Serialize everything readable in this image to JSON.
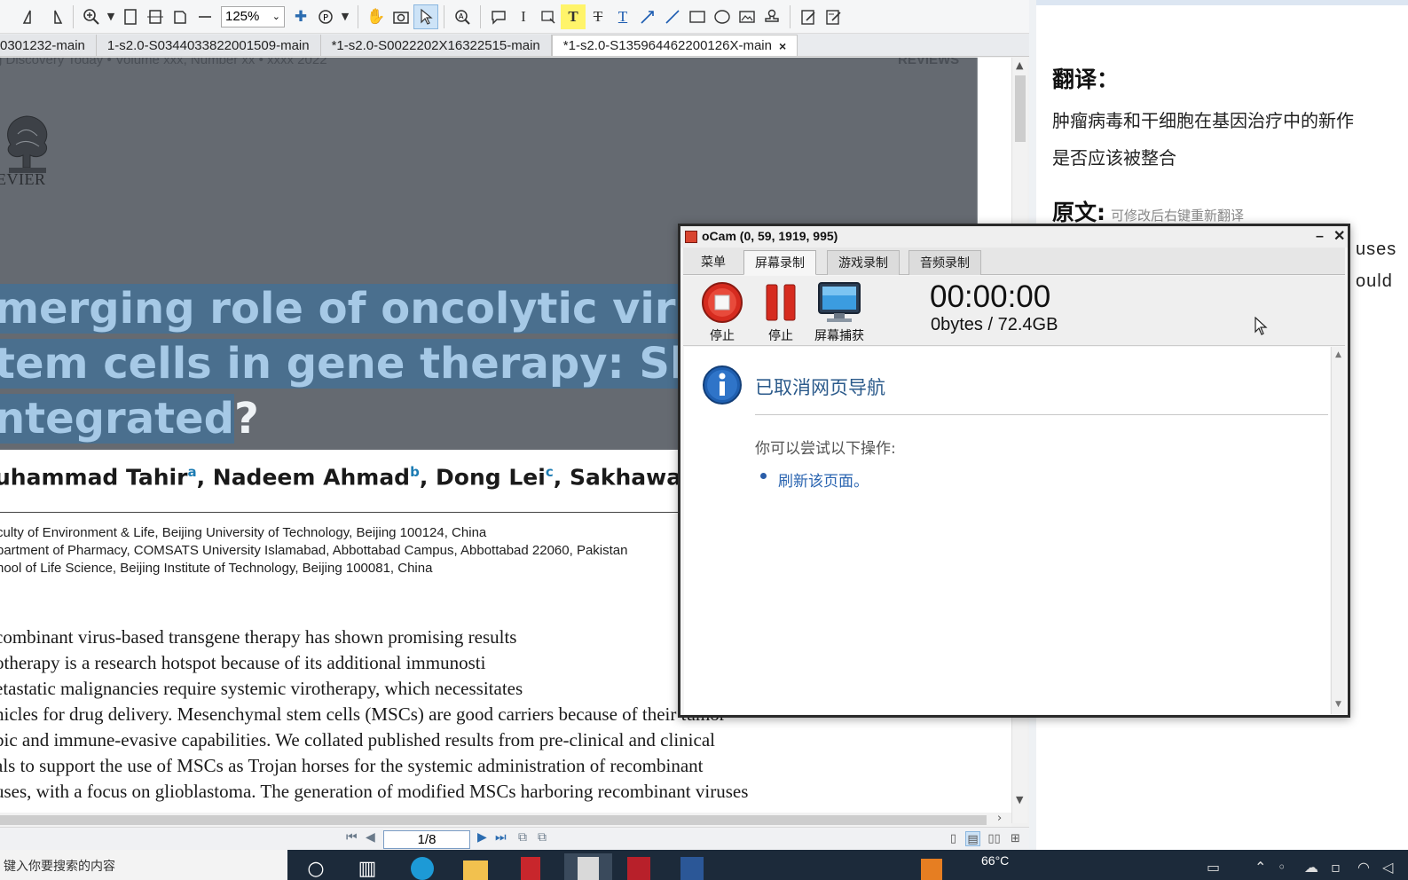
{
  "toolbar": {
    "zoom_value": "125%",
    "icons": [
      "rotate-left-icon",
      "rotate-right-icon",
      "zoom-in-icon",
      "fit-page-icon",
      "fit-width-icon",
      "actual-size-icon",
      "zoom-out-icon",
      "add-icon",
      "pan-icon",
      "snapshot-icon",
      "select-icon",
      "find-icon",
      "comment-icon",
      "text-select-icon",
      "textbox-icon",
      "highlight-icon",
      "strikethrough-icon",
      "underline-icon",
      "arrow-icon",
      "line-icon",
      "rectangle-icon",
      "ellipse-icon",
      "image-icon",
      "stamp-icon",
      "sign-icon",
      "edit-icon"
    ],
    "highlight_label": "T",
    "strike_label": "T",
    "underline_label": "T"
  },
  "tabs": [
    {
      "label": "0301232-main",
      "active": false
    },
    {
      "label": "1-s2.0-S0344033822001509-main",
      "active": false
    },
    {
      "label": "*1-s2.0-S0022202X16322515-main",
      "active": false
    },
    {
      "label": "*1-s2.0-S135964462200126X-main",
      "active": true,
      "close": "×"
    }
  ],
  "document": {
    "journal_line": "g Discovery Today • Volume xxx, Number xx • xxxx 2022",
    "section_label": "REVIEWS",
    "publisher": "EVIER",
    "title_lines": [
      {
        "hl": "merging role of oncolytic viru",
        "rest": ""
      },
      {
        "hl": "tem cells in gene therapy: Sho",
        "rest": ""
      },
      {
        "hl": "ntegrated",
        "rest": "?"
      }
    ],
    "authors": [
      {
        "name": "uhammad Tahir",
        "sup": "a"
      },
      {
        "name": "Nadeem Ahmad",
        "sup": "b"
      },
      {
        "name": "Dong Lei",
        "sup": "c"
      },
      {
        "name": "Sakhawat A",
        "sup": ""
      }
    ],
    "affiliations": [
      "culty of Environment & Life, Beijing University of Technology, Beijing 100124, China",
      "partment of Pharmacy, COMSATS University Islamabad, Abbottabad Campus, Abbottabad 22060, Pakistan",
      "nool of Life Science, Beijing Institute of Technology, Beijing 100081, China"
    ],
    "abstract_lines": [
      "combinant virus-based transgene therapy has shown promising results",
      "otherapy is a research hotspot because of its additional immunosti",
      "etastatic malignancies require systemic virotherapy, which necessitates",
      "hicles for drug delivery. Mesenchymal stem cells (MSCs) are good carriers because of their tumor",
      "pic and immune-evasive capabilities. We collated published results from pre-clinical and clinical",
      "als to support the use of MSCs as Trojan horses for the systemic administration of recombinant",
      "uses, with a focus on glioblastoma. The generation of modified MSCs harboring recombinant viruses"
    ]
  },
  "pagebar": {
    "page": "1/8"
  },
  "translation": {
    "heading": "翻译：",
    "text_line1": "肿瘤病毒和干细胞在基因治疗中的新作",
    "text_line2": "是否应该被整合",
    "orig_heading": "原文:",
    "orig_hint": "可修改后右键重新翻译",
    "orig_frag1": "uses",
    "orig_frag2": "ould"
  },
  "ocam": {
    "title": "oCam (0, 59, 1919, 995)",
    "tabs": [
      "菜单",
      "屏幕录制",
      "游戏录制",
      "音频录制"
    ],
    "active_tab": "屏幕录制",
    "stop_label": "停止",
    "pause_label": "停止",
    "capture_label": "屏幕捕获",
    "timer": "00:00:00",
    "size": "0bytes / 72.4GB",
    "nav_cancelled": "已取消网页导航",
    "nav_try": "你可以尝试以下操作:",
    "nav_refresh": "刷新该页面。"
  },
  "taskbar": {
    "search_text": "键入你要搜索的内容",
    "weather": "66°C",
    "apps": [
      "search-icon",
      "task-view-icon",
      "edge-icon",
      "file-explorer-icon",
      "pdf-app-icon",
      "foxit-icon",
      "zotero-icon",
      "word-icon"
    ]
  },
  "colors": {
    "page_header": "#656a71",
    "title_text": "#9fc3e0",
    "selection": "#4a6f8e",
    "link_blue": "#2a64b0",
    "stop_red": "#d62b1f",
    "taskbar": "#1c2a3a"
  }
}
